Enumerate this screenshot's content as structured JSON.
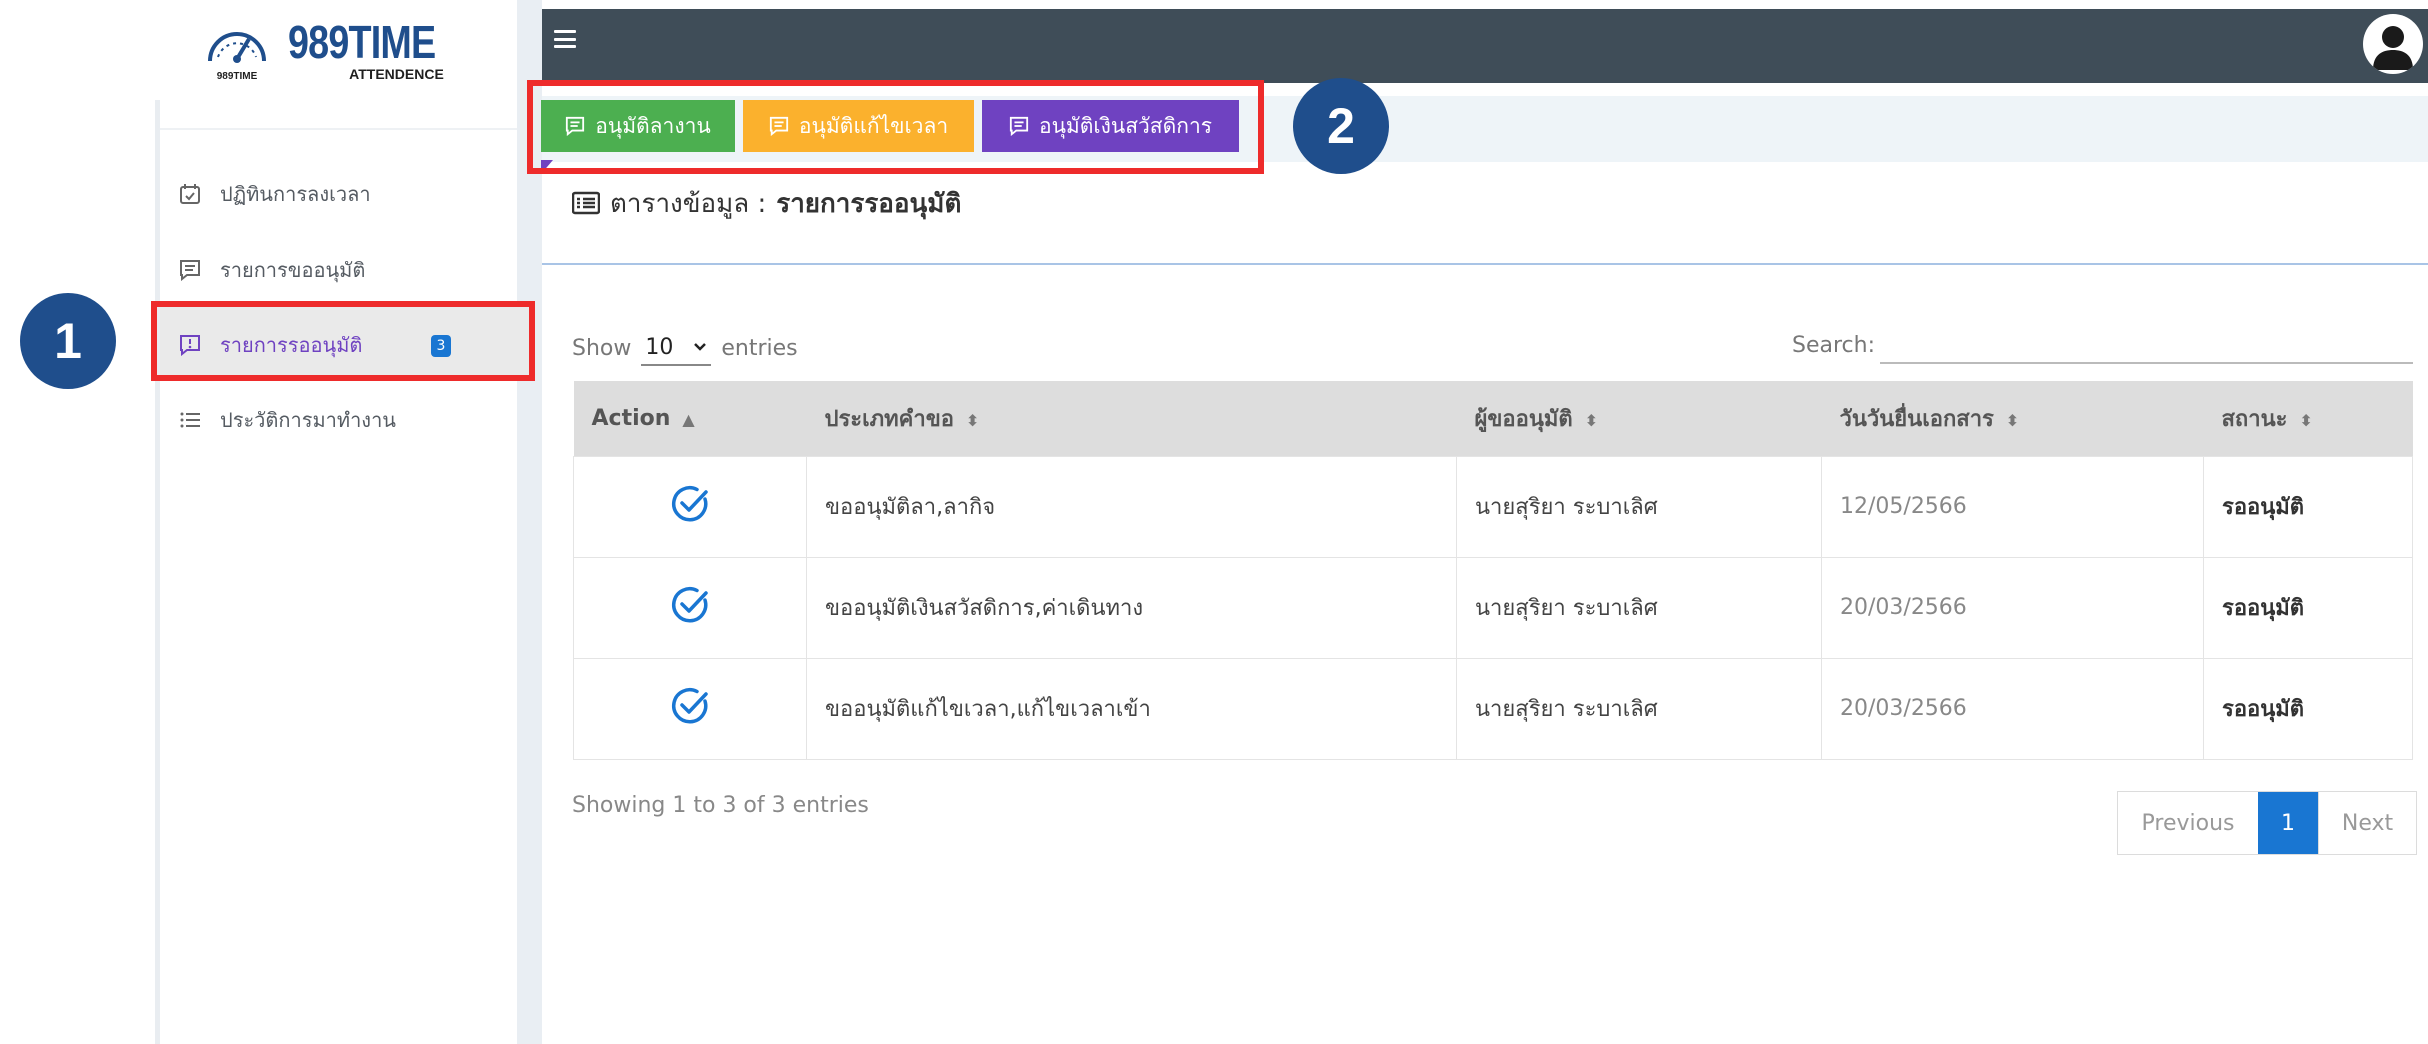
{
  "logo": {
    "title": "989TIME",
    "subtitle": "ATTENDENCE",
    "gauge_caption": "989TIME"
  },
  "topbar": {
    "menu_icon": "hamburger-icon",
    "avatar_icon": "user-avatar-icon"
  },
  "sidebar": {
    "items": [
      {
        "label": "ปฏิทินการลงเวลา",
        "icon": "calendar-check-icon"
      },
      {
        "label": "รายการขออนุมัติ",
        "icon": "message-lines-icon"
      },
      {
        "label": "รายการรออนุมัติ",
        "icon": "message-alert-icon",
        "badge": "3"
      },
      {
        "label": "ประวัติการมาทำงาน",
        "icon": "list-icon"
      }
    ]
  },
  "actions": {
    "leave": "อนุมัติลางาน",
    "time_fix": "อนุมัติแก้ไขเวลา",
    "welfare": "อนุมัติเงินสวัสดิการ"
  },
  "markers": {
    "one": "1",
    "two": "2"
  },
  "card": {
    "prefix": "ตารางข้อมูล :",
    "title": "รายการรออนุมัติ"
  },
  "table_controls": {
    "show": "Show",
    "entries_value": "10",
    "entries": "entries",
    "search": "Search:",
    "search_value": ""
  },
  "table": {
    "headers": [
      "Action",
      "ประเภทคำขอ",
      "ผู้ขออนุมัติ",
      "วันวันยื่นเอกสาร",
      "สถานะ"
    ],
    "rows": [
      {
        "type": "ขออนุมัติลา,ลากิจ",
        "requester": "นายสุริยา ระบาเลิศ",
        "date": "12/05/2566",
        "status": "รออนุมัติ"
      },
      {
        "type": "ขออนุมัติเงินสวัสดิการ,ค่าเดินทาง",
        "requester": "นายสุริยา ระบาเลิศ",
        "date": "20/03/2566",
        "status": "รออนุมัติ"
      },
      {
        "type": "ขออนุมัติแก้ไขเวลา,แก้ไขเวลาเข้า",
        "requester": "นายสุริยา ระบาเลิศ",
        "date": "20/03/2566",
        "status": "รออนุมัติ"
      }
    ],
    "info": "Showing 1 to 3 of 3 entries"
  },
  "pagination": {
    "previous": "Previous",
    "current": "1",
    "next": "Next"
  },
  "colors": {
    "topbar": "#3f4d58",
    "green": "#4caf50",
    "orange": "#fbb12d",
    "purple": "#6f42c1",
    "blue": "#1976d2",
    "highlight": "#ee2b2b",
    "marker": "#1f4e8c"
  }
}
